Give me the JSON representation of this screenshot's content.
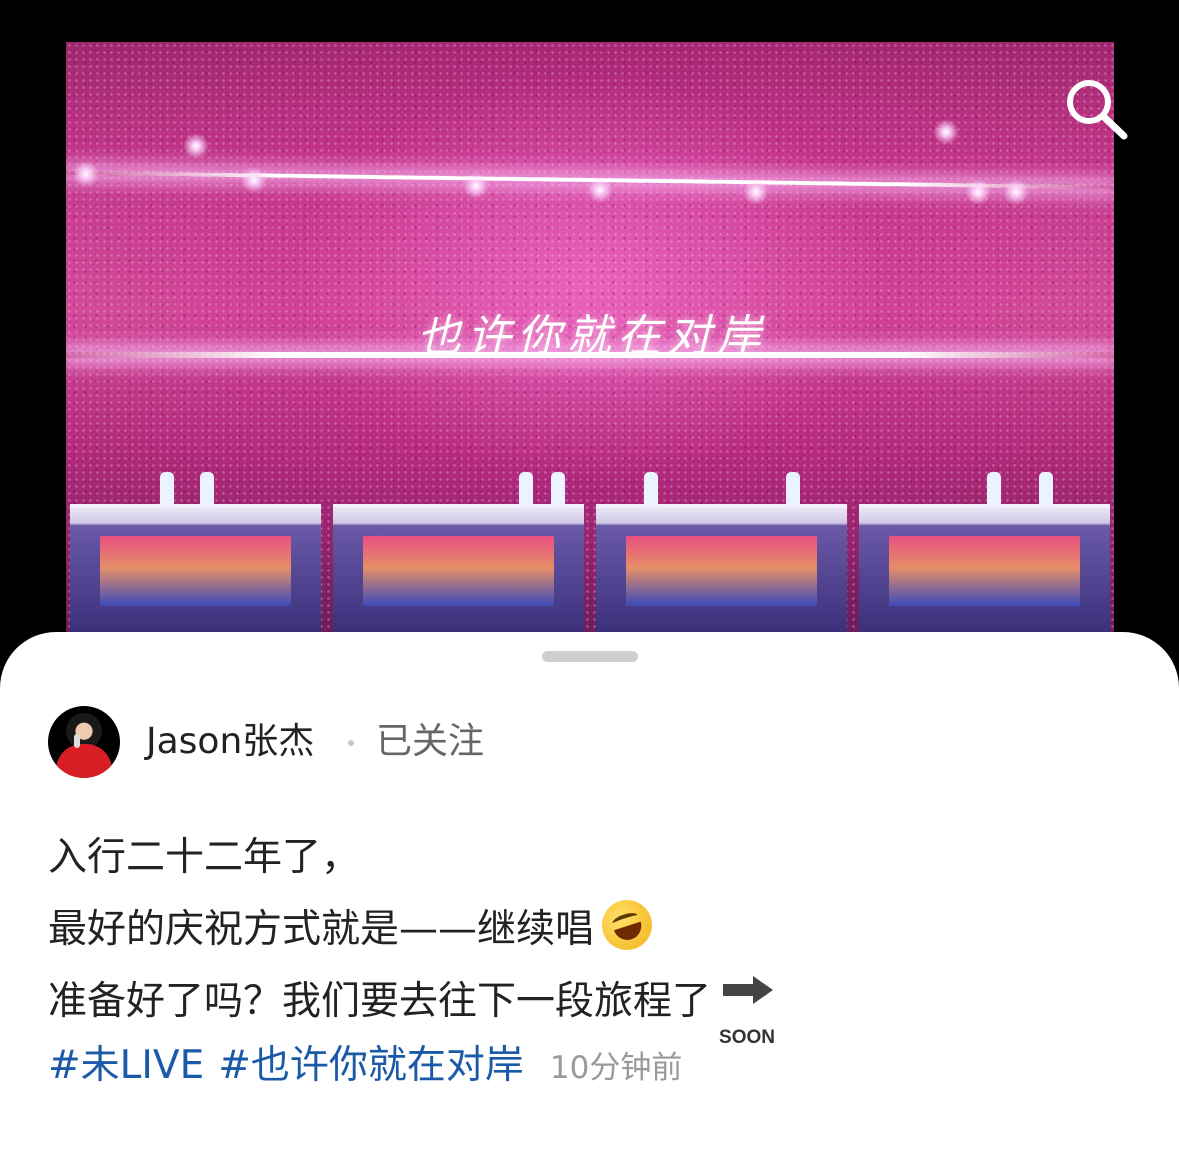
{
  "video": {
    "overlay_title": "也许你就在对岸",
    "search_icon": "search-icon"
  },
  "post": {
    "username": "Jason张杰",
    "follow_status": "已关注",
    "lines": [
      "入行二十二年了，",
      "最好的庆祝方式就是——继续唱",
      "准备好了吗？我们要去往下一段旅程了"
    ],
    "emoji_line2": "rolling-on-floor-laughing-emoji",
    "soon_label": "SOON",
    "tags": [
      "#未LIVE",
      "#也许你就在对岸"
    ],
    "timestamp": "10分钟前"
  },
  "colors": {
    "tag": "#1a5aa8",
    "video_tint": "#c2378a",
    "sheet": "#ffffff"
  }
}
